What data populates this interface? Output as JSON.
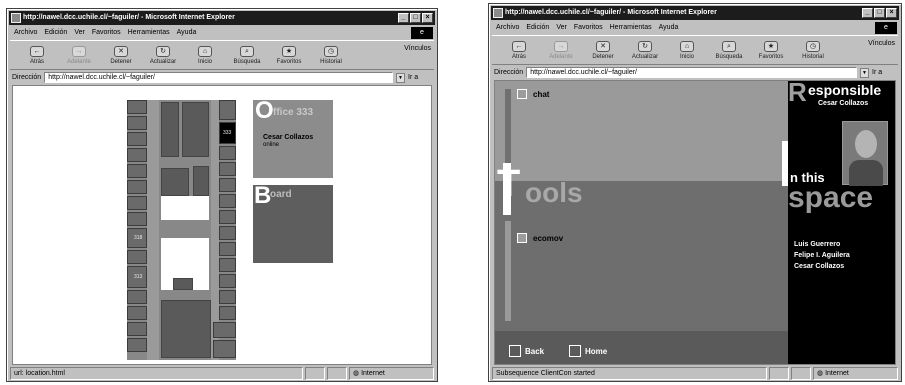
{
  "left_window": {
    "title": "http://nawel.dcc.uchile.cl/~faguiler/ - Microsoft Internet Explorer",
    "menu": [
      "Archivo",
      "Edición",
      "Ver",
      "Favoritos",
      "Herramientas",
      "Ayuda"
    ],
    "toolbar": [
      {
        "label": "Atrás",
        "icon": "back-arrow-icon",
        "disabled": false
      },
      {
        "label": "Adelante",
        "icon": "forward-arrow-icon",
        "disabled": true
      },
      {
        "label": "Detener",
        "icon": "stop-icon",
        "disabled": false
      },
      {
        "label": "Actualizar",
        "icon": "refresh-icon",
        "disabled": false
      },
      {
        "label": "Inicio",
        "icon": "home-icon",
        "disabled": false
      },
      {
        "label": "Búsqueda",
        "icon": "search-icon",
        "disabled": false
      },
      {
        "label": "Favoritos",
        "icon": "favorites-icon",
        "disabled": false
      },
      {
        "label": "Historial",
        "icon": "history-icon",
        "disabled": false
      }
    ],
    "links_label": "Vínculos",
    "address_label": "Dirección",
    "address_value": "http://nawel.dcc.uchile.cl/~faguiler/",
    "go_label": "Ir a",
    "status_text": "url: location.html",
    "status_zone": "Internet",
    "map_labels": {
      "office": "333",
      "lab1": "318",
      "lab2": "313"
    },
    "office_card": {
      "initial": "O",
      "title": "ffice 333",
      "name": "Cesar Collazos",
      "presence": "online"
    },
    "board_card": {
      "initial": "B",
      "title": "oard"
    }
  },
  "right_window": {
    "title": "http://nawel.dcc.uchile.cl/~faguiler/ - Microsoft Internet Explorer",
    "menu": [
      "Archivo",
      "Edición",
      "Ver",
      "Favoritos",
      "Herramientas",
      "Ayuda"
    ],
    "toolbar": [
      {
        "label": "Atrás",
        "icon": "back-arrow-icon",
        "disabled": false
      },
      {
        "label": "Adelante",
        "icon": "forward-arrow-icon",
        "disabled": true
      },
      {
        "label": "Detener",
        "icon": "stop-icon",
        "disabled": false
      },
      {
        "label": "Actualizar",
        "icon": "refresh-icon",
        "disabled": false
      },
      {
        "label": "Inicio",
        "icon": "home-icon",
        "disabled": false
      },
      {
        "label": "Búsqueda",
        "icon": "search-icon",
        "disabled": false
      },
      {
        "label": "Favoritos",
        "icon": "favorites-icon",
        "disabled": false
      },
      {
        "label": "Historial",
        "icon": "history-icon",
        "disabled": false
      }
    ],
    "links_label": "Vínculos",
    "address_label": "Dirección",
    "address_value": "http://nawel.dcc.uchile.cl/~faguiler/",
    "go_label": "Ir a",
    "status_text": "Subsequence ClientCon started",
    "status_zone": "Internet",
    "page": {
      "tools_initial": "T",
      "tools_rest": "ools",
      "chat_label": "chat",
      "ecomov_label": "ecomov",
      "responsible_initial": "R",
      "responsible_rest": "esponsible",
      "responsible_name": "Cesar Collazos",
      "in_this": "n this",
      "space": "space",
      "members": [
        "Luis Guerrero",
        "Felipe I. Aguilera",
        "Cesar Collazos"
      ],
      "back_label": "Back",
      "home_label": "Home"
    }
  },
  "colors": {
    "title_bar": "#1c1c1c",
    "chrome": "#c0c0c0",
    "panel_dark": "#5c5c5c",
    "panel_mid": "#8e8e8e",
    "black_panel": "#000000"
  }
}
